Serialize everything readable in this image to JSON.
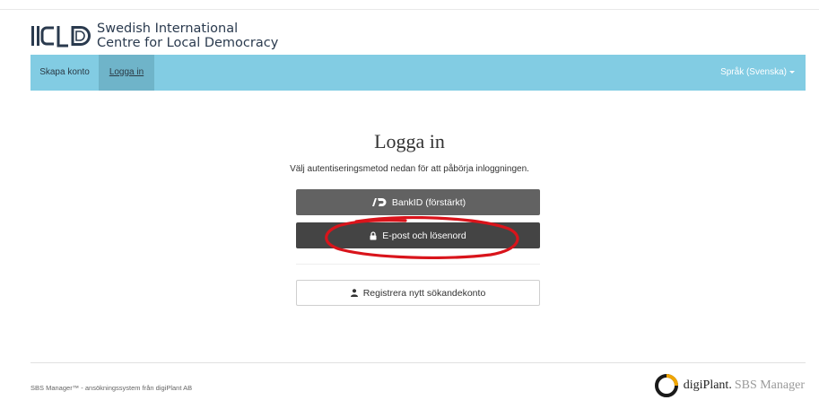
{
  "header": {
    "org_line1": "Swedish International",
    "org_line2": "Centre for Local Democracy",
    "logo_icon": "icld-logo"
  },
  "navbar": {
    "create_account": "Skapa konto",
    "login": "Logga in",
    "language": "Språk (Svenska)",
    "color": "#82cce3"
  },
  "main": {
    "title": "Logga in",
    "subtitle": "Välj autentiseringsmetod nedan för att påbörja inloggningen.",
    "bankid_label": "BankID (förstärkt)",
    "email_label": "E-post och lösenord",
    "register_label": "Registrera nytt sökandekonto"
  },
  "footer": {
    "text": "SBS Manager™ - ansökningssystem från digiPlant AB",
    "brand_name": "digiPlant.",
    "brand_sub": "SBS Manager"
  },
  "annotation": {
    "color": "#d9141b",
    "shape": "hand-drawn ellipse around email login button"
  }
}
